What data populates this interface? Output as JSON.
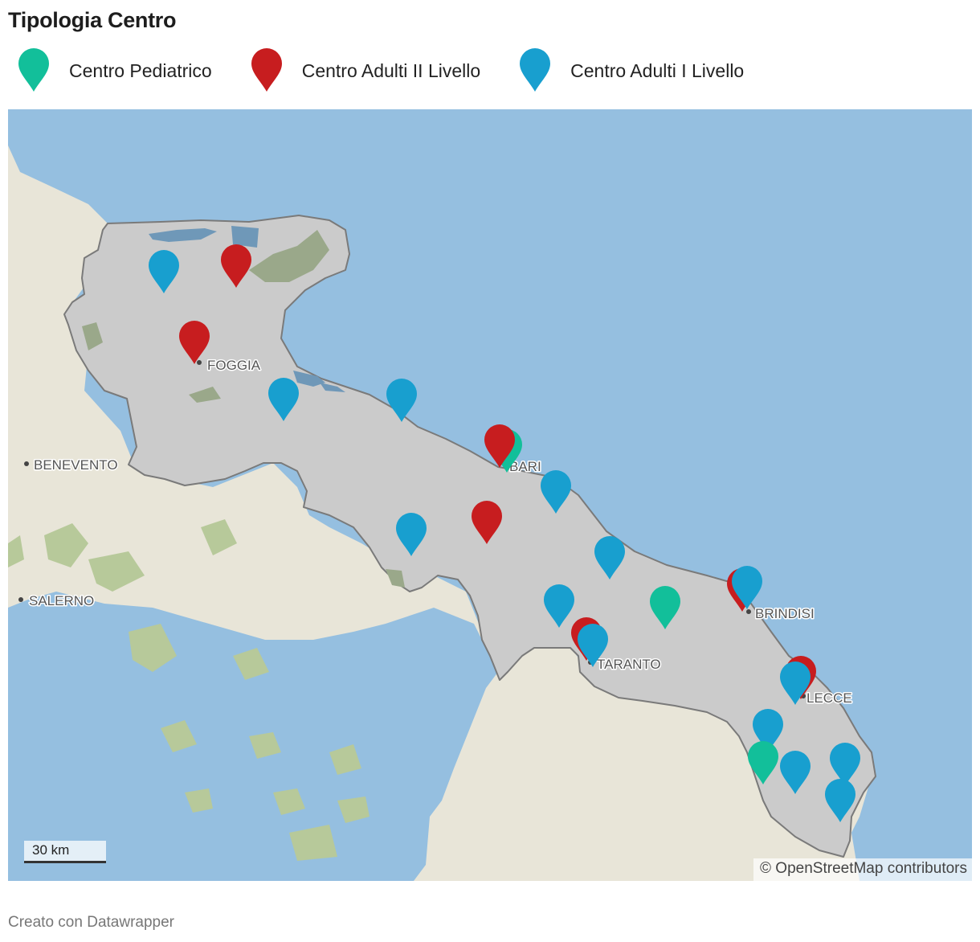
{
  "title": "Tipologia Centro",
  "legend": [
    {
      "key": "pediatrico",
      "label": "Centro Pediatrico",
      "color": "#12bf9a"
    },
    {
      "key": "adulti2",
      "label": "Centro Adulti II Livello",
      "color": "#c71d1f"
    },
    {
      "key": "adulti1",
      "label": "Centro Adulti I Livello",
      "color": "#189fcf"
    }
  ],
  "colors": {
    "sea": "#95bfe0",
    "land": "#e8e5d8",
    "region": "#cbcbcb",
    "region_border": "#7a7a7a",
    "parks": "#b7c99a",
    "parks_region": "#9aa88a",
    "lakes": "#6f98b8"
  },
  "cities": [
    "FOGGIA",
    "BENEVENTO",
    "BARI",
    "SALERNO",
    "BRINDISI",
    "TARANTO",
    "LECCE"
  ],
  "scale": "30 km",
  "attribution": "© OpenStreetMap contributors",
  "footer": "Creato con Datawrapper"
}
